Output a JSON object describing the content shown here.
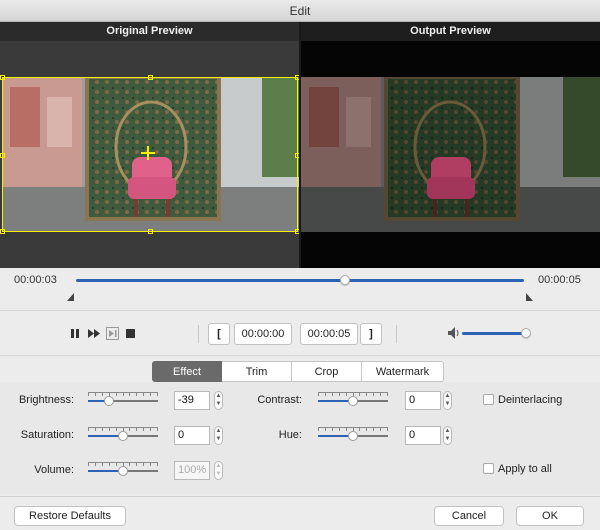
{
  "window": {
    "title": "Edit"
  },
  "preview": {
    "original_label": "Original Preview",
    "output_label": "Output Preview"
  },
  "timeline": {
    "current_time": "00:00:03",
    "total_time": "00:00:05",
    "progress_fraction": 0.6
  },
  "playback": {
    "pause_icon": "pause-icon",
    "next_frame_icon": "next-frame-icon",
    "step_icon": "step-icon",
    "stop_icon": "stop-icon",
    "start_bracket": "[",
    "start_time": "00:00:00",
    "end_time": "00:00:05",
    "end_bracket": "]",
    "volume_icon": "speaker-icon",
    "volume_level": 0.97
  },
  "tabs": [
    {
      "label": "Effect",
      "active": true
    },
    {
      "label": "Trim",
      "active": false
    },
    {
      "label": "Crop",
      "active": false
    },
    {
      "label": "Watermark",
      "active": false
    }
  ],
  "effect": {
    "brightness": {
      "label": "Brightness:",
      "value": "-39",
      "level": 0.3
    },
    "contrast": {
      "label": "Contrast:",
      "value": "0",
      "level": 0.5
    },
    "saturation": {
      "label": "Saturation:",
      "value": "0",
      "level": 0.5
    },
    "hue": {
      "label": "Hue:",
      "value": "0",
      "level": 0.5
    },
    "volume": {
      "label": "Volume:",
      "value": "100%",
      "level": 0.5
    },
    "deinterlacing": {
      "label": "Deinterlacing",
      "checked": false
    },
    "apply_to_all": {
      "label": "Apply to all",
      "checked": false
    }
  },
  "footer": {
    "restore_label": "Restore Defaults",
    "cancel_label": "Cancel",
    "ok_label": "OK"
  },
  "colors": {
    "accent": "#2e62b5",
    "crop_outline": "#f3f200",
    "active_tab": "#6a6a6a"
  }
}
